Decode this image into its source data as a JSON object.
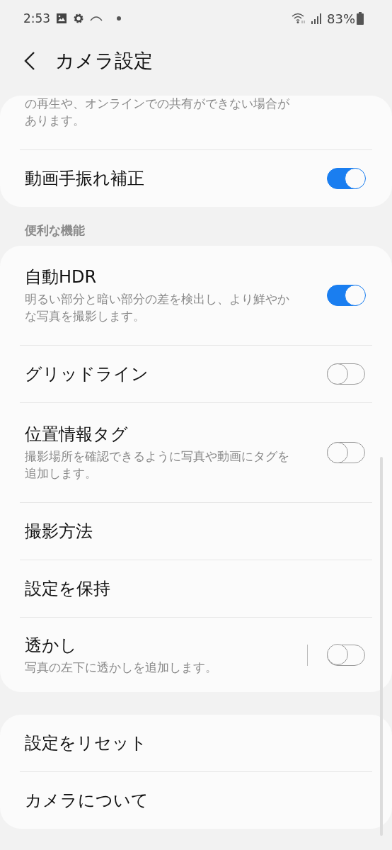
{
  "status_bar": {
    "time": "2:53",
    "battery": "83%"
  },
  "header": {
    "title": "カメラ設定"
  },
  "groups": [
    {
      "items": [
        {
          "kind": "note",
          "subtitle": "の再生や、オンラインでの共有ができない場合があります。"
        },
        {
          "kind": "switch",
          "title": "動画手振れ補正",
          "on": true
        }
      ]
    },
    {
      "heading": "便利な機能",
      "items": [
        {
          "kind": "switch",
          "title": "自動HDR",
          "subtitle": "明るい部分と暗い部分の差を検出し、より鮮やかな写真を撮影します。",
          "on": true
        },
        {
          "kind": "switch",
          "title": "グリッドライン",
          "on": false
        },
        {
          "kind": "switch",
          "title": "位置情報タグ",
          "subtitle": "撮影場所を確認できるように写真や動画にタグを追加します。",
          "on": false
        },
        {
          "kind": "link",
          "title": "撮影方法"
        },
        {
          "kind": "link",
          "title": "設定を保持"
        },
        {
          "kind": "split-switch",
          "title": "透かし",
          "subtitle": "写真の左下に透かしを追加します。",
          "on": false
        }
      ]
    },
    {
      "items": [
        {
          "kind": "link",
          "title": "設定をリセット"
        },
        {
          "kind": "link",
          "title": "カメラについて"
        }
      ]
    }
  ]
}
